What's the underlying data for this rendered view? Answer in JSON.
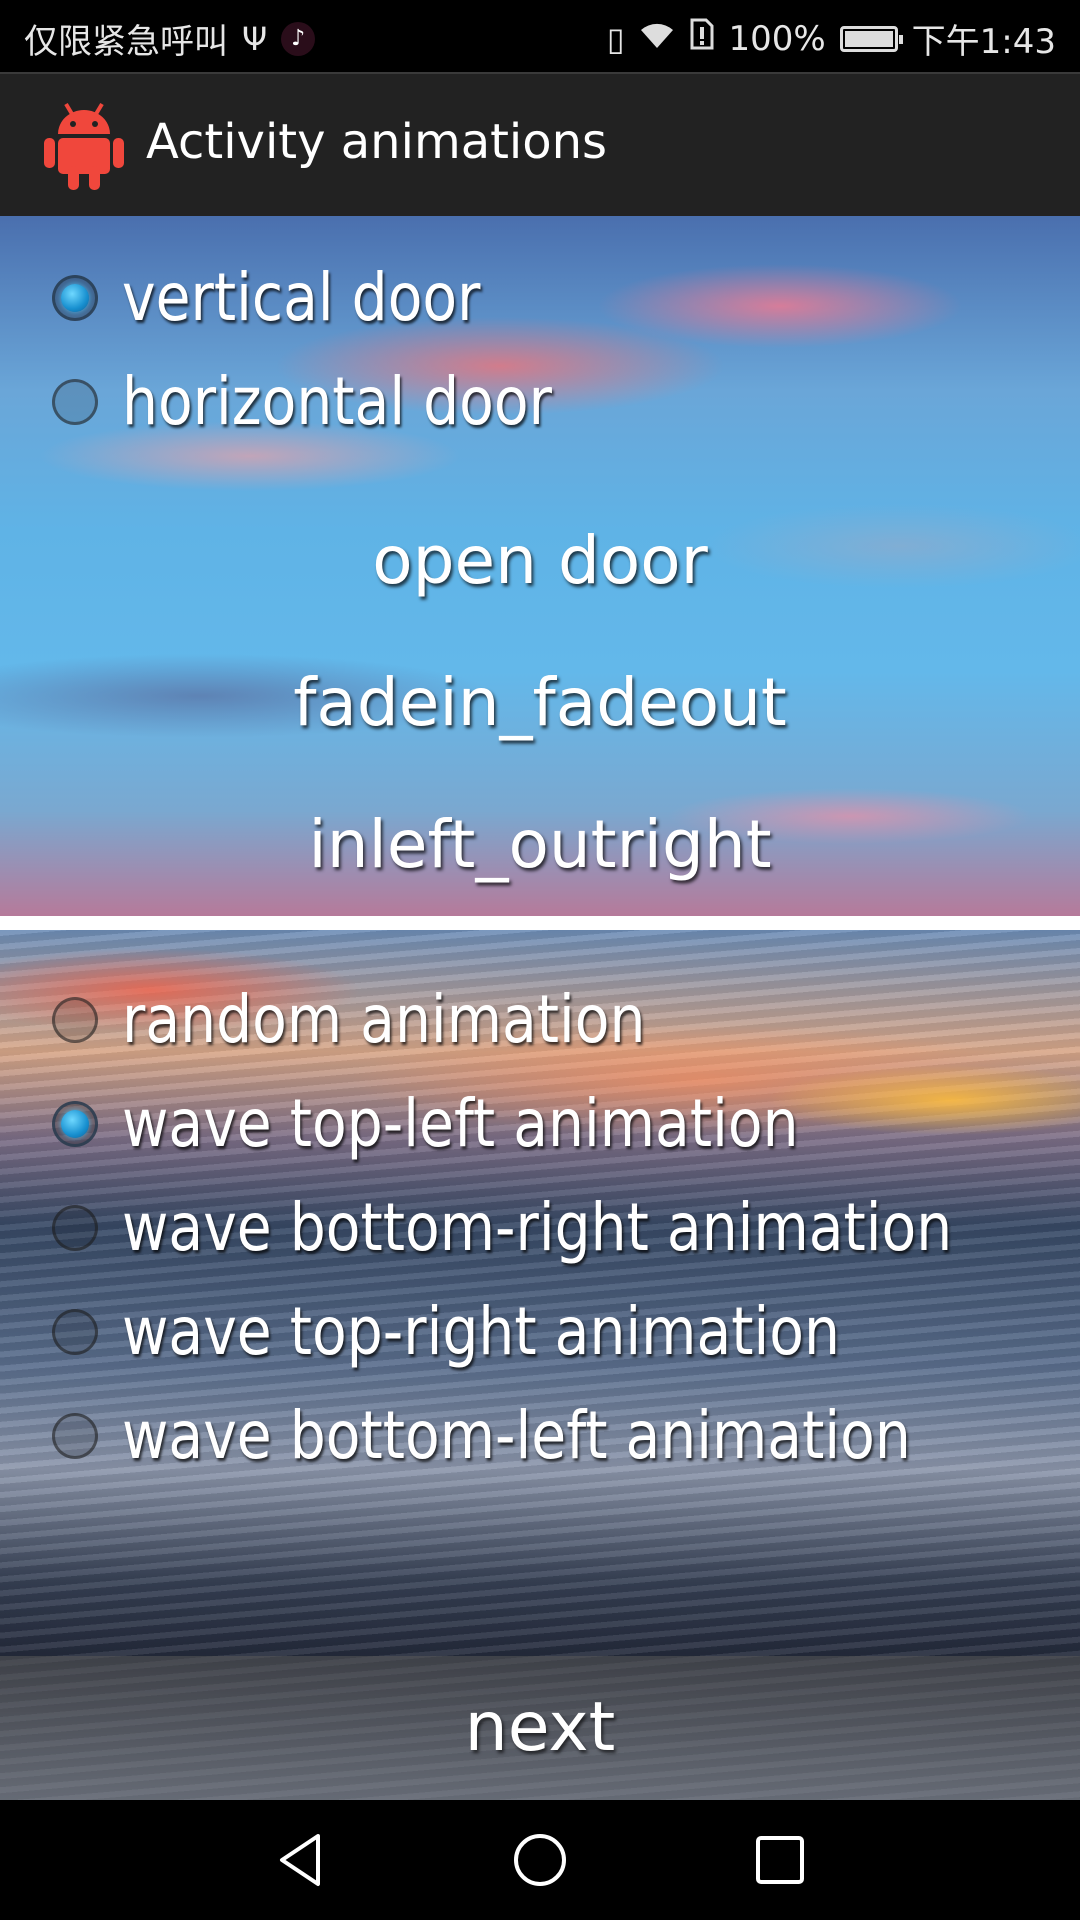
{
  "status_bar": {
    "carrier": "仅限紧急呼叫",
    "battery": "100%",
    "time": "下午1:43"
  },
  "action_bar": {
    "title": "Activity animations",
    "logo_color": "#f0473c"
  },
  "door_options": [
    {
      "label": "vertical door",
      "checked": true
    },
    {
      "label": "horizontal door",
      "checked": false
    }
  ],
  "buttons": {
    "open_door": "open door",
    "fadein_fadeout": "fadein_fadeout",
    "inleft_outright": "inleft_outright",
    "next": "next"
  },
  "wave_options": [
    {
      "label": "random animation",
      "checked": false
    },
    {
      "label": "wave top-left animation",
      "checked": true
    },
    {
      "label": "wave bottom-right animation",
      "checked": false
    },
    {
      "label": "wave top-right animation",
      "checked": false
    },
    {
      "label": "wave bottom-left animation",
      "checked": false
    }
  ],
  "colors": {
    "radio_selected": "#1890d0",
    "action_bar_bg": "#222222"
  }
}
